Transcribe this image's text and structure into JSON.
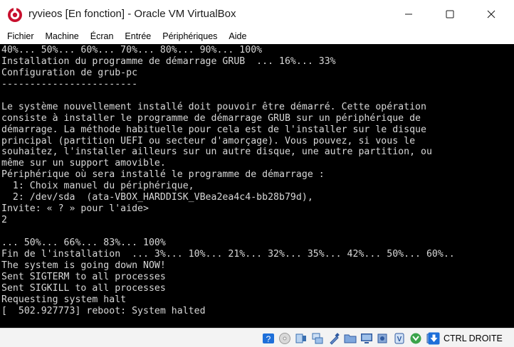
{
  "window": {
    "title": "ryvieos [En fonction] - Oracle VM VirtualBox"
  },
  "menu": {
    "items": [
      {
        "label": "Fichier"
      },
      {
        "label": "Machine"
      },
      {
        "label": "Écran"
      },
      {
        "label": "Entrée"
      },
      {
        "label": "Périphériques"
      },
      {
        "label": "Aide"
      }
    ]
  },
  "console": {
    "lines": [
      "40%... 50%... 60%... 70%... 80%... 90%... 100%",
      "Installation du programme de démarrage GRUB  ... 16%... 33%",
      "Configuration de grub-pc",
      "------------------------",
      "",
      "Le système nouvellement installé doit pouvoir être démarré. Cette opération",
      "consiste à installer le programme de démarrage GRUB sur un périphérique de",
      "démarrage. La méthode habituelle pour cela est de l'installer sur le disque",
      "principal (partition UEFI ou secteur d'amorçage). Vous pouvez, si vous le",
      "souhaitez, l'installer ailleurs sur un autre disque, une autre partition, ou",
      "même sur un support amovible.",
      "Périphérique où sera installé le programme de démarrage :",
      "  1: Choix manuel du périphérique,",
      "  2: /dev/sda  (ata-VBOX_HARDDISK_VBea2ea4c4-bb28b79d),",
      "Invite: « ? » pour l'aide>",
      "2",
      "",
      "... 50%... 66%... 83%... 100%",
      "Fin de l'installation  ... 3%... 10%... 21%... 32%... 35%... 42%... 50%... 60%..",
      "The system is going down NOW!",
      "Sent SIGTERM to all processes",
      "Sent SIGKILL to all processes",
      "Requesting system halt",
      "[  502.927773] reboot: System halted"
    ]
  },
  "statusbar": {
    "icons": [
      "optical-drive-icon",
      "floppy-icon",
      "audio-icon",
      "network-icon",
      "usb-icon",
      "shared-folders-icon",
      "display-icon",
      "recording-icon",
      "cpu-icon",
      "mouse-integration-icon",
      "capture-icon"
    ],
    "host_key_label": "CTRL DROITE"
  },
  "colors": {
    "console_bg": "#000000",
    "console_fg": "#d8d8d8",
    "logo_red": "#c8102e",
    "accent_blue": "#1e6fd9"
  }
}
